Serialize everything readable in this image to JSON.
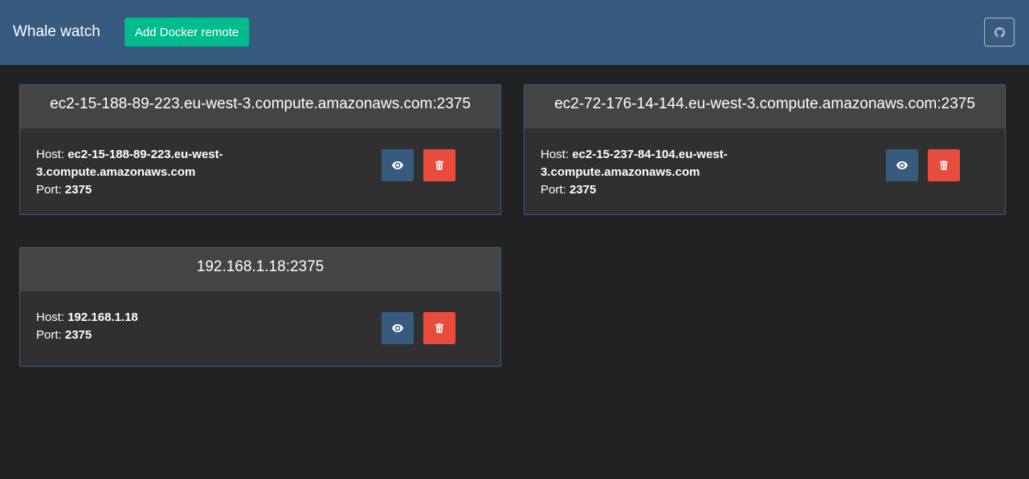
{
  "navbar": {
    "brand": "Whale watch",
    "add_button_label": "Add Docker remote",
    "github_icon": "github-icon"
  },
  "remotes": [
    {
      "title": "ec2-15-188-89-223.eu-west-3.compute.amazonaws.com:2375",
      "host_label": "Host: ",
      "host_line1": "ec2-15-188-89-223.eu-west-",
      "host_line2": "3.compute.amazonaws.com",
      "port_label": "Port: ",
      "port": "2375",
      "view_icon": "eye-icon",
      "delete_icon": "trash-icon"
    },
    {
      "title": "ec2-72-176-14-144.eu-west-3.compute.amazonaws.com:2375",
      "host_label": "Host: ",
      "host_line1": "ec2-15-237-84-104.eu-west-",
      "host_line2": "3.compute.amazonaws.com",
      "port_label": "Port: ",
      "port": "2375",
      "view_icon": "eye-icon",
      "delete_icon": "trash-icon"
    },
    {
      "title": "192.168.1.18:2375",
      "host_label": "Host: ",
      "host_line1": "192.168.1.18",
      "host_line2": "",
      "port_label": "Port: ",
      "port": "2375",
      "view_icon": "eye-icon",
      "delete_icon": "trash-icon"
    }
  ],
  "colors": {
    "navbar": "#375a7f",
    "add_button": "#00bc8c",
    "view_button": "#375a7f",
    "delete_button": "#e74c3c",
    "background": "#222222"
  }
}
